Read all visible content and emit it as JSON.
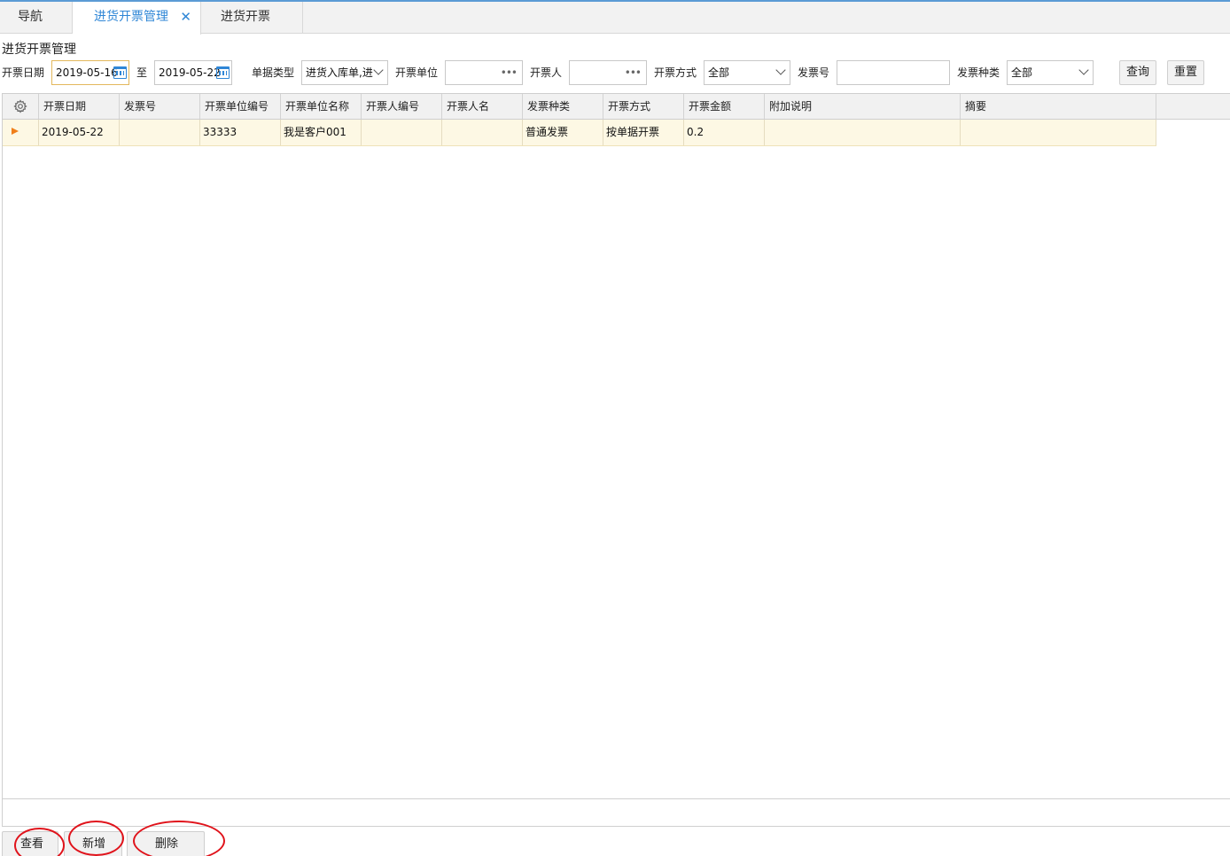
{
  "tabs": [
    {
      "label": "导航"
    },
    {
      "label": "进货开票管理",
      "close": "✕"
    },
    {
      "label": "进货开票"
    }
  ],
  "page_title": "进货开票管理",
  "filters": {
    "date_label": "开票日期",
    "date_from": "2019-05-16",
    "date_sep": "至",
    "date_to": "2019-05-22",
    "doc_type_label": "单据类型",
    "doc_type_value": "进货入库单,进",
    "unit_label": "开票单位",
    "unit_value": "",
    "person_label": "开票人",
    "person_value": "",
    "method_label": "开票方式",
    "method_value": "全部",
    "invoice_no_label": "发票号",
    "invoice_no_value": "",
    "invoice_kind_label": "发票种类",
    "invoice_kind_value": "全部",
    "query_button": "查询",
    "reset_button": "重置",
    "ellipsis": "•••"
  },
  "grid": {
    "columns": [
      "开票日期",
      "发票号",
      "开票单位编号",
      "开票单位名称",
      "开票人编号",
      "开票人名",
      "发票种类",
      "开票方式",
      "开票金额",
      "附加说明",
      "摘要"
    ],
    "rows": [
      [
        "2019-05-22",
        "",
        "33333",
        "我是客户001",
        "",
        "",
        "普通发票",
        "按单据开票",
        "0.2",
        "",
        ""
      ]
    ]
  },
  "actions": {
    "view": "查看",
    "add": "新增",
    "delete": "删除"
  },
  "colors": {
    "accent": "#2f86d6",
    "selected_row": "#fdf8e4",
    "annotation": "#e0131b",
    "row_marker": "#f07f1a"
  }
}
